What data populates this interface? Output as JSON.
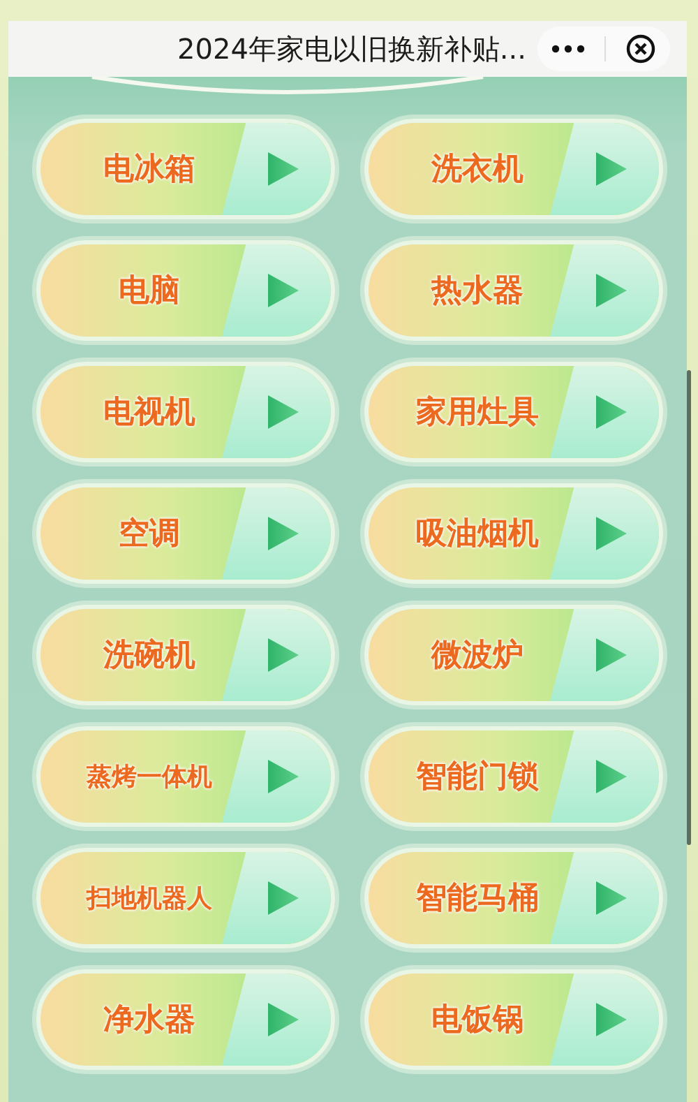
{
  "window": {
    "title": "2024年家电以旧换新补贴..."
  },
  "categories": [
    {
      "label": "电冰箱"
    },
    {
      "label": "洗衣机"
    },
    {
      "label": "电脑"
    },
    {
      "label": "热水器"
    },
    {
      "label": "电视机"
    },
    {
      "label": "家用灶具"
    },
    {
      "label": "空调"
    },
    {
      "label": "吸油烟机"
    },
    {
      "label": "洗碗机"
    },
    {
      "label": "微波炉"
    },
    {
      "label": "蒸烤一体机"
    },
    {
      "label": "智能门锁"
    },
    {
      "label": "扫地机器人"
    },
    {
      "label": "智能马桶"
    },
    {
      "label": "净水器"
    },
    {
      "label": "电饭锅"
    }
  ]
}
